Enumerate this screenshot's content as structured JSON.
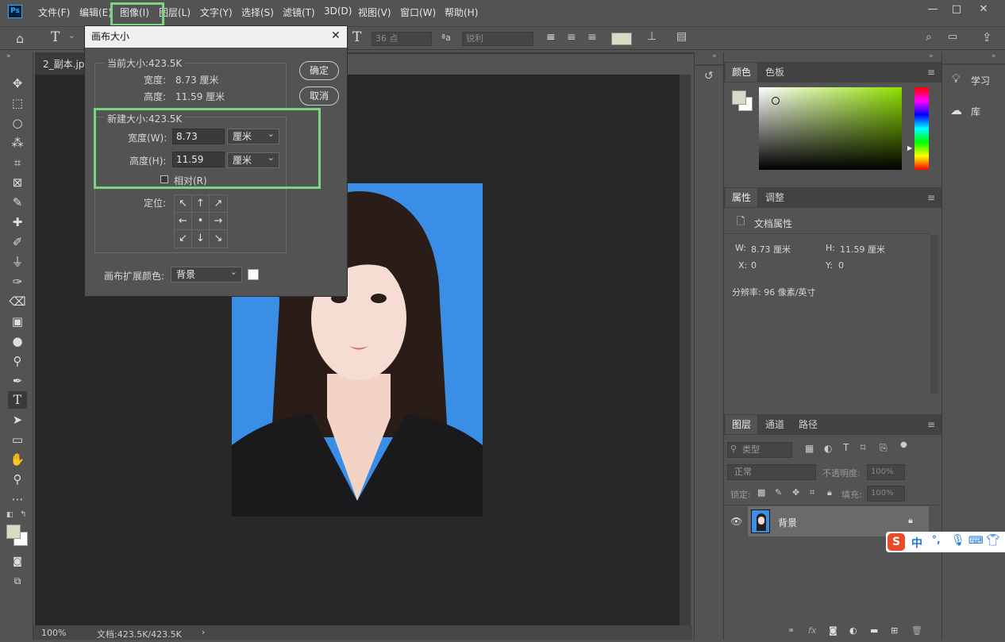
{
  "app_logo": "Ps",
  "menu": {
    "items": [
      "文件(F)",
      "编辑(E)",
      "图像(I)",
      "图层(L)",
      "文字(Y)",
      "选择(S)",
      "滤镜(T)",
      "3D(D)",
      "视图(V)",
      "窗口(W)",
      "帮助(H)"
    ]
  },
  "window_controls": {
    "minimize": "—",
    "maximize": "□",
    "close": "✕"
  },
  "options_bar": {
    "font_size": "36 点",
    "aa_label": "ªa",
    "aa_mode": "锐利"
  },
  "document_tab": "2_副本.jpg",
  "dialog": {
    "title": "画布大小",
    "close": "✕",
    "current_size_label": "当前大小:423.5K",
    "current_width_label": "宽度:",
    "current_width_value": "8.73 厘米",
    "current_height_label": "高度:",
    "current_height_value": "11.59 厘米",
    "ok": "确定",
    "cancel": "取消",
    "new_size_label": "新建大小:423.5K",
    "width_label": "宽度(W):",
    "width_value": "8.73",
    "width_unit": "厘米",
    "height_label": "高度(H):",
    "height_value": "11.59",
    "height_unit": "厘米",
    "relative_label": "相对(R)",
    "anchor_label": "定位:",
    "anchor_arrows": [
      "↖",
      "↑",
      "↗",
      "←",
      "•",
      "→",
      "↙",
      "↓",
      "↘"
    ],
    "ext_color_label": "画布扩展颜色:",
    "ext_color_value": "背景"
  },
  "color_panel": {
    "tabs": [
      "颜色",
      "色板"
    ]
  },
  "properties_panel": {
    "tabs": [
      "属性",
      "调整"
    ],
    "doc_props": "文档属性",
    "w_label": "W:",
    "w_value": "8.73 厘米",
    "h_label": "H:",
    "h_value": "11.59 厘米",
    "x_label": "X:",
    "x_value": "0",
    "y_label": "Y:",
    "y_value": "0",
    "resolution": "分辨率: 96 像素/英寸"
  },
  "learn_panel": {
    "learn": "学习",
    "library": "库"
  },
  "layers_panel": {
    "tabs": [
      "图层",
      "通道",
      "路径"
    ],
    "kind_filter": "类型",
    "blend_mode": "正常",
    "opacity_label": "不透明度:",
    "opacity_value": "100%",
    "lock_label": "锁定:",
    "fill_label": "填充:",
    "fill_value": "100%",
    "layer_name": "背景"
  },
  "ime": {
    "logo": "S",
    "lang": "中",
    "punct": "°,"
  },
  "status_bar": {
    "zoom": "100%",
    "doc_info": "文档:423.5K/423.5K",
    "arrow": "›"
  },
  "colors": {
    "bg_ui": "#535353",
    "canvas": "#282828",
    "photo_bg": "#3a8ee6",
    "highlight": "#7bd47f",
    "foreground_color": "#d4dcc4",
    "background_color": "#ffffff"
  }
}
